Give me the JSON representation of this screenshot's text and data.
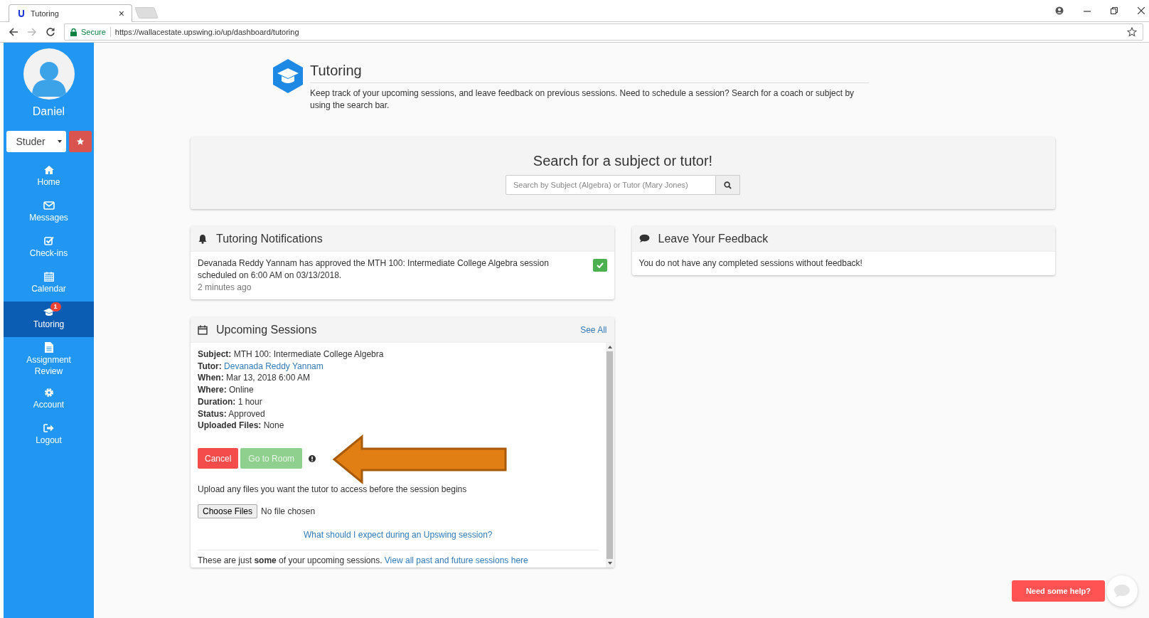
{
  "browser": {
    "tab_title": "Tutoring",
    "tab_close": "×",
    "secure_label": "Secure",
    "url": "https://wallacestate.upswing.io/up/dashboard/tutoring"
  },
  "sidebar": {
    "user_name": "Daniel",
    "role_select": "Studer",
    "items": [
      {
        "label": "Home",
        "selected": false
      },
      {
        "label": "Messages",
        "selected": false
      },
      {
        "label": "Check-ins",
        "selected": false
      },
      {
        "label": "Calendar",
        "selected": false
      },
      {
        "label": "Tutoring",
        "selected": true,
        "badge": "1"
      },
      {
        "label": "Assignment Review",
        "selected": false
      },
      {
        "label": "Account",
        "selected": false
      },
      {
        "label": "Logout",
        "selected": false
      }
    ]
  },
  "page": {
    "title": "Tutoring",
    "description": "Keep track of your upcoming sessions, and leave feedback on previous sessions. Need to schedule a session? Search for a coach or subject by using the search bar."
  },
  "search": {
    "title": "Search for a subject or tutor!",
    "placeholder": "Search by Subject (Algebra) or Tutor (Mary Jones)"
  },
  "notifications": {
    "title": "Tutoring Notifications",
    "items": [
      {
        "text": "Devanada Reddy Yannam has approved the MTH 100: Intermediate College Algebra session scheduled on 6:00 AM on 03/13/2018.",
        "time": "2 minutes ago",
        "approved": true
      }
    ]
  },
  "feedback": {
    "title": "Leave Your Feedback",
    "message": "You do not have any completed sessions without feedback!"
  },
  "upcoming": {
    "title": "Upcoming Sessions",
    "see_all": "See All",
    "fields": [
      {
        "label": "Subject:",
        "value": "MTH 100: Intermediate College Algebra",
        "kind": "text"
      },
      {
        "label": "Tutor:",
        "value": "Devanada Reddy Yannam",
        "kind": "link"
      },
      {
        "label": "When:",
        "value": "Mar 13, 2018 6:00 AM",
        "kind": "text"
      },
      {
        "label": "Where:",
        "value": "Online",
        "kind": "text"
      },
      {
        "label": "Duration:",
        "value": "1 hour",
        "kind": "text"
      },
      {
        "label": "Status:",
        "value": "Approved",
        "kind": "text"
      },
      {
        "label": "Uploaded Files:",
        "value": "None",
        "kind": "text"
      }
    ],
    "cancel_button": "Cancel",
    "room_button": {
      "label": "Go to Room",
      "disabled": true
    },
    "upload_hint": "Upload any files you want the tutor to access before the session begins",
    "file_button": "Choose Files",
    "file_status": "No file chosen",
    "help_link": "What should I expect during an Upswing session?",
    "footer_note": "These are just **some** of your upcoming sessions.",
    "footer_link": "View all past and future sessions here"
  },
  "help_widget": {
    "label": "Need some help?"
  }
}
